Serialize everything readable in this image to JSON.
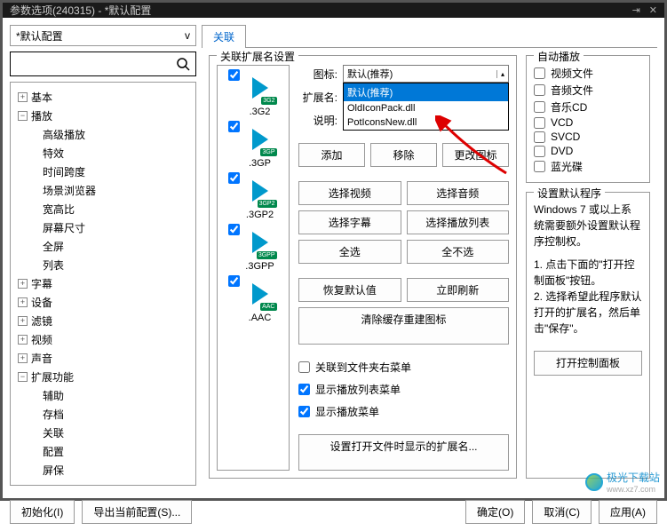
{
  "titlebar": {
    "title": "参数选项(240315) - *默认配置"
  },
  "profile": {
    "selected": "*默认配置",
    "arrow": "v"
  },
  "tree": {
    "items": [
      {
        "label": "基本",
        "level": 1,
        "toggle": "+"
      },
      {
        "label": "播放",
        "level": 1,
        "toggle": "−"
      },
      {
        "label": "高级播放",
        "level": 2
      },
      {
        "label": "特效",
        "level": 2
      },
      {
        "label": "时间跨度",
        "level": 2
      },
      {
        "label": "场景浏览器",
        "level": 2
      },
      {
        "label": "宽高比",
        "level": 2
      },
      {
        "label": "屏幕尺寸",
        "level": 2
      },
      {
        "label": "全屏",
        "level": 2
      },
      {
        "label": "列表",
        "level": 2
      },
      {
        "label": "字幕",
        "level": 1,
        "toggle": "+"
      },
      {
        "label": "设备",
        "level": 1,
        "toggle": "+"
      },
      {
        "label": "滤镜",
        "level": 1,
        "toggle": "+"
      },
      {
        "label": "视频",
        "level": 1,
        "toggle": "+"
      },
      {
        "label": "声音",
        "level": 1,
        "toggle": "+"
      },
      {
        "label": "扩展功能",
        "level": 1,
        "toggle": "−"
      },
      {
        "label": "辅助",
        "level": 2
      },
      {
        "label": "存档",
        "level": 2
      },
      {
        "label": "关联",
        "level": 2
      },
      {
        "label": "配置",
        "level": 2
      },
      {
        "label": "屏保",
        "level": 2
      }
    ]
  },
  "tab": {
    "label": "关联"
  },
  "assoc": {
    "title": "关联扩展名设置",
    "formats": [
      {
        "label": ".3G2",
        "badge": "3G2",
        "checked": true
      },
      {
        "label": ".3GP",
        "badge": "3GP",
        "checked": true
      },
      {
        "label": ".3GP2",
        "badge": "3GP2",
        "checked": true
      },
      {
        "label": ".3GPP",
        "badge": "3GPP",
        "checked": true
      },
      {
        "label": ".AAC",
        "badge": "AAC",
        "checked": true,
        "badgeGray": false
      }
    ],
    "form": {
      "icon_label": "图标:",
      "icon_value": "默认(推荐)",
      "dropdown": [
        {
          "text": "默认(推荐)",
          "selected": true
        },
        {
          "text": "OldIconPack.dll",
          "selected": false
        },
        {
          "text": "PotIconsNew.dll",
          "selected": false
        }
      ],
      "ext_label": "扩展名:",
      "desc_label": "说明:"
    },
    "buttons": {
      "add": "添加",
      "remove": "移除",
      "change_icon": "更改图标",
      "sel_video": "选择视频",
      "sel_audio": "选择音频",
      "sel_sub": "选择字幕",
      "sel_playlist": "选择播放列表",
      "sel_all": "全选",
      "sel_none": "全不选",
      "restore": "恢复默认值",
      "refresh": "立即刷新",
      "clear_cache": "清除缓存重建图标",
      "set_open_ext": "设置打开文件时显示的扩展名..."
    },
    "checkboxes": {
      "folder_menu": "关联到文件夹右菜单",
      "playlist_menu": "显示播放列表菜单",
      "play_menu": "显示播放菜单"
    }
  },
  "autoplay": {
    "title": "自动播放",
    "items": [
      "视频文件",
      "音频文件",
      "音乐CD",
      "VCD",
      "SVCD",
      "DVD",
      "蓝光碟"
    ]
  },
  "default_prog": {
    "title": "设置默认程序",
    "line1": "Windows 7 或以上系统需要额外设置默认程序控制权。",
    "step1": "1. 点击下面的\"打开控制面板\"按钮。",
    "step2": "2. 选择希望此程序默认打开的扩展名，然后单击\"保存\"。",
    "open_cp": "打开控制面板"
  },
  "footer": {
    "init": "初始化(I)",
    "export": "导出当前配置(S)...",
    "ok": "确定(O)",
    "cancel": "取消(C)",
    "apply": "应用(A)"
  },
  "watermark": {
    "name": "极光下载站",
    "url": "www.xz7.com"
  }
}
